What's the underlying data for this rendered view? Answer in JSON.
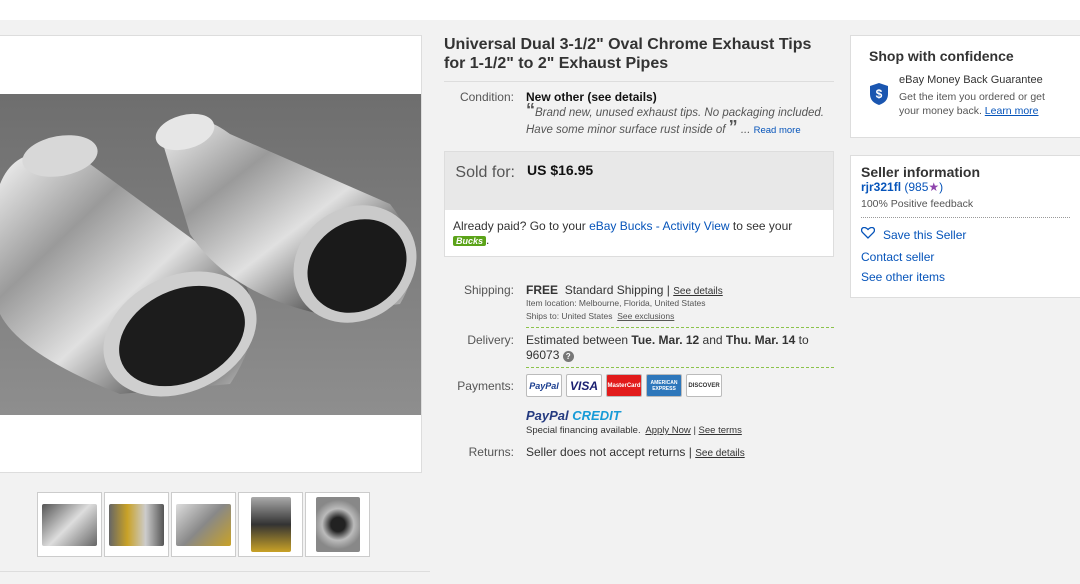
{
  "item": {
    "title": "Universal Dual 3-1/2\" Oval Chrome Exhaust Tips for 1-1/2\" to 2\" Exhaust Pipes"
  },
  "condition": {
    "label": "Condition:",
    "value": "New other (see details)",
    "quote": "Brand new, unused exhaust tips. No packaging included. Have some minor surface rust inside of",
    "ellipsis": "...",
    "read_more": "Read more"
  },
  "price": {
    "label": "Sold for:",
    "value": "US $16.95",
    "paid_pre": "Already paid? Go to your ",
    "paid_link": "eBay Bucks - Activity View",
    "paid_post": " to see your ",
    "bucks_badge": "Bucks",
    "paid_end": "."
  },
  "shipping": {
    "label": "Shipping:",
    "free": "FREE",
    "method": "Standard Shipping |",
    "see_details": "See details",
    "item_location": "Item location:  Melbourne, Florida, United States",
    "ships_to": "Ships to:  United States",
    "see_exclusions": "See exclusions"
  },
  "delivery": {
    "label": "Delivery:",
    "pre": "Estimated between ",
    "date1": "Tue. Mar. 12",
    "mid": " and ",
    "date2": "Thu. Mar. 14",
    "post": " to",
    "zip": "96073"
  },
  "payments": {
    "label": "Payments:",
    "cards": [
      "PayPal",
      "VISA",
      "MasterCard",
      "AMERICAN EXPRESS",
      "DISCOVER"
    ],
    "paypal_credit_1": "PayPal",
    "paypal_credit_2": " CREDIT",
    "financing": "Special financing available.",
    "apply_now": "Apply Now",
    "sep": "|",
    "see_terms": "See terms"
  },
  "returns": {
    "label": "Returns:",
    "value": "Seller does not accept returns |",
    "see_details": "See details"
  },
  "confidence": {
    "title": "Shop with confidence",
    "guarantee_title": "eBay Money Back Guarantee",
    "guarantee_text": "Get the item you ordered or get your money back.",
    "learn_more": "Learn more"
  },
  "seller": {
    "title": "Seller information",
    "name": "rjr321fl",
    "feedback_score": "(985",
    "star": "★",
    "close_paren": ")",
    "positive": "100% Positive feedback",
    "save": "Save this Seller",
    "contact": "Contact seller",
    "see_other": "See other items"
  },
  "colors": {
    "link": "#0654ba",
    "ebay_blue": "#1a56b0",
    "bucks_green": "#5ba319",
    "dotted_green": "#8bc34a"
  },
  "icons": [
    "shield-dollar-icon",
    "heart-icon",
    "help-icon",
    "star-icon"
  ]
}
